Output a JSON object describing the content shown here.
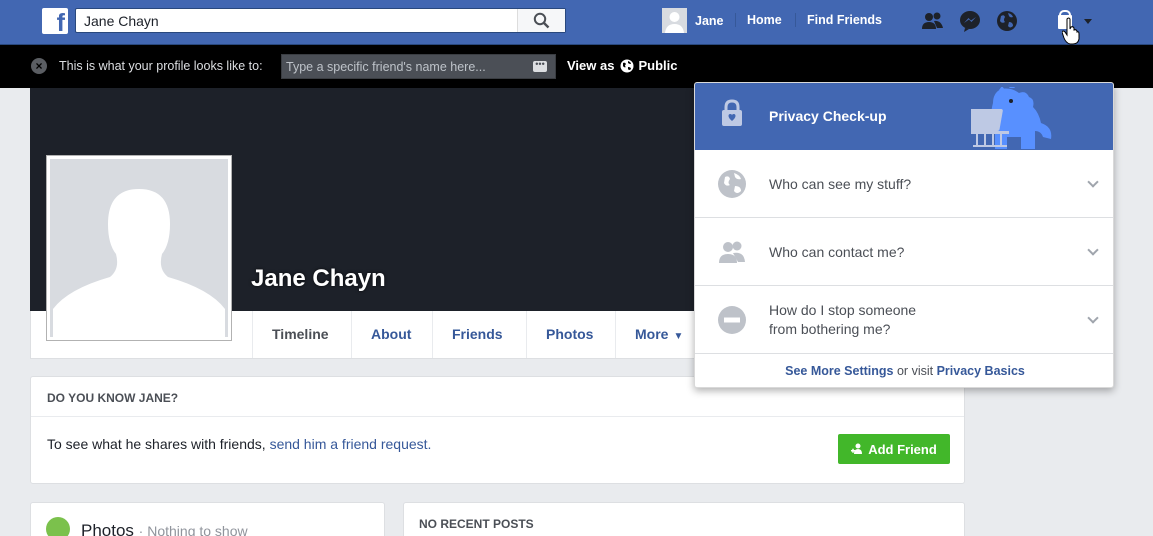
{
  "topbar": {
    "search_value": "Jane Chayn",
    "user_name": "Jane",
    "home": "Home",
    "find_friends": "Find Friends"
  },
  "viewas": {
    "message": "This is what your profile looks like to:",
    "input_placeholder": "Type a specific friend's name here...",
    "view_as_label": "View as",
    "audience": "Public"
  },
  "profile": {
    "name": "Jane Chayn",
    "tabs": [
      "Timeline",
      "About",
      "Friends",
      "Photos",
      "More"
    ]
  },
  "know_card": {
    "heading": "DO YOU KNOW JANE?",
    "text": "To see what he shares with friends,",
    "link": "send him a friend request.",
    "button": "Add Friend"
  },
  "photos_card": {
    "title": "Photos",
    "subtitle": "· Nothing to show"
  },
  "posts_card": {
    "title": "NO RECENT POSTS"
  },
  "privacy_menu": {
    "title": "Privacy Check-up",
    "items": [
      "Who can see my stuff?",
      "Who can contact me?",
      "How do I stop someone",
      "from bothering me?"
    ],
    "footer_link1": "See More Settings",
    "footer_mid": "or visit",
    "footer_link2": "Privacy Basics"
  },
  "colors": {
    "brand": "#4267b2",
    "add_friend": "#42b72a"
  }
}
